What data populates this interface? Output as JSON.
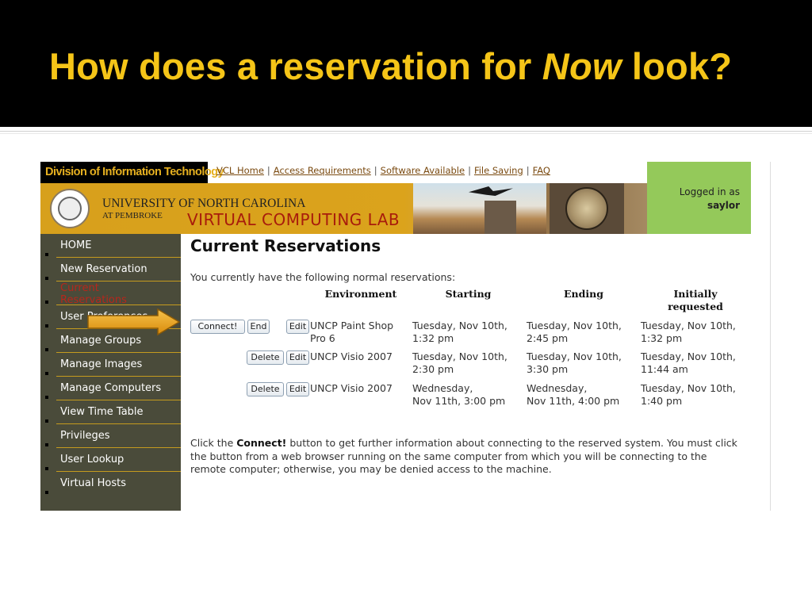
{
  "slide": {
    "title_before": "How does a reservation for ",
    "title_em": "Now",
    "title_after": " look?"
  },
  "site": {
    "division": "Division of Information Technology",
    "toplinks": [
      {
        "label": "VCL Home"
      },
      {
        "label": "Access Requirements"
      },
      {
        "label": "Software Available"
      },
      {
        "label": "File Saving"
      },
      {
        "label": "FAQ"
      }
    ],
    "university_line1": "UNIVERSITY OF NORTH CAROLINA",
    "university_line2": "AT PEMBROKE",
    "lab_title": "VIRTUAL COMPUTING LAB",
    "login_label": "Logged in as",
    "login_user": "saylor"
  },
  "sidebar": {
    "items": [
      {
        "label": "HOME"
      },
      {
        "label": "New Reservation"
      },
      {
        "label": "Current\nReservations",
        "active": true
      },
      {
        "label": "User Preferences"
      },
      {
        "label": "Manage Groups"
      },
      {
        "label": "Manage Images"
      },
      {
        "label": "Manage Computers"
      },
      {
        "label": "View Time Table"
      },
      {
        "label": "Privileges"
      },
      {
        "label": "User Lookup"
      },
      {
        "label": "Virtual Hosts"
      }
    ]
  },
  "main": {
    "page_title": "Current Reservations",
    "intro": "You currently have the following normal reservations:",
    "columns": {
      "environment": "Environment",
      "starting": "Starting",
      "ending": "Ending",
      "initially": "Initially\nrequested"
    },
    "rows": [
      {
        "buttons": [
          "Connect!",
          "End",
          "Edit"
        ],
        "environment": "UNCP Paint Shop\nPro 6",
        "starting": "Tuesday, Nov 10th,\n1:32 pm",
        "ending": "Tuesday, Nov 10th,\n2:45 pm",
        "initially": "Tuesday, Nov 10th,\n1:32 pm"
      },
      {
        "buttons": [
          "Delete",
          "Edit"
        ],
        "environment": "UNCP Visio 2007",
        "starting": "Tuesday, Nov 10th,\n2:30 pm",
        "ending": "Tuesday, Nov 10th,\n3:30 pm",
        "initially": "Tuesday, Nov 10th,\n11:44 am"
      },
      {
        "buttons": [
          "Delete",
          "Edit"
        ],
        "environment": "UNCP Visio 2007",
        "starting": "Wednesday,\nNov 11th, 3:00 pm",
        "ending": "Wednesday,\nNov 11th, 4:00 pm",
        "initially": "Tuesday, Nov 10th,\n1:40 pm"
      }
    ],
    "footer_before": "Click the ",
    "footer_bold": "Connect!",
    "footer_after": " button to get further information about connecting to the reserved system. You must click the button from a web browser running on the same computer from which you will be connecting to the remote computer; otherwise, you may be denied access to the machine."
  },
  "colors": {
    "slide_title": "#f5c518",
    "banner_gold": "#d7a01c",
    "sidebar_bg": "#4a4b3a",
    "active_nav": "#b6271c",
    "login_green": "#94c95a",
    "arrow_orange": "#e8a317"
  },
  "icons": {
    "arrow": "right-arrow-icon",
    "seal": "university-seal-icon"
  }
}
